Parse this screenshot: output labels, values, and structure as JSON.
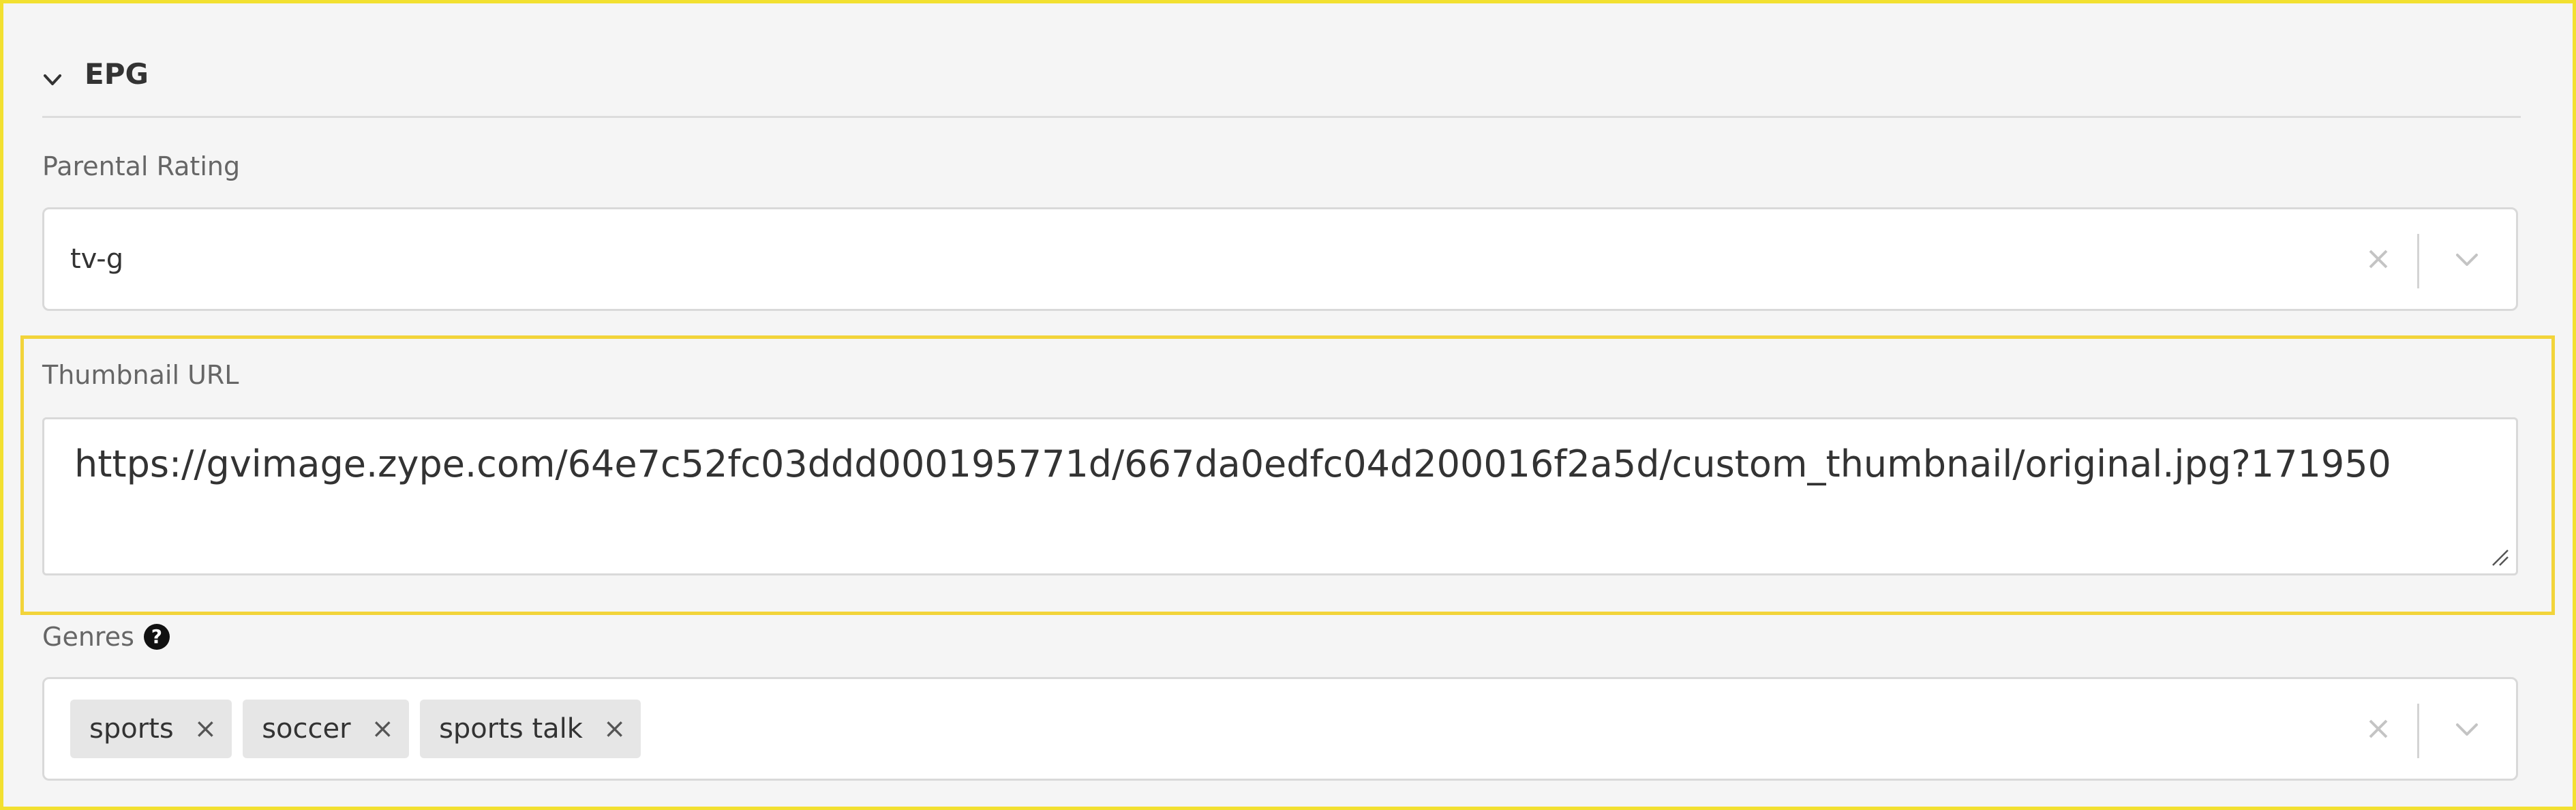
{
  "section": {
    "title": "EPG",
    "chevron_icon": "chevron-down-icon"
  },
  "parental_rating": {
    "label": "Parental Rating",
    "value": "tv-g",
    "clear_icon": "close-icon",
    "dropdown_icon": "chevron-down-icon"
  },
  "thumbnail": {
    "label": "Thumbnail URL",
    "value": "https://gvimage.zype.com/64e7c52fc03ddd000195771d/667da0edfc04d200016f2a5d/custom_thumbnail/original.jpg?171950"
  },
  "genres": {
    "label": "Genres",
    "help_icon_glyph": "?",
    "tags": [
      {
        "label": "sports",
        "remove": "×"
      },
      {
        "label": "soccer",
        "remove": "×"
      },
      {
        "label": "sports talk",
        "remove": "×"
      }
    ],
    "clear_icon": "close-icon",
    "dropdown_icon": "chevron-down-icon"
  },
  "colors": {
    "highlight": "#f2d43a",
    "frame": "#f2e030",
    "background": "#f5f5f5"
  }
}
